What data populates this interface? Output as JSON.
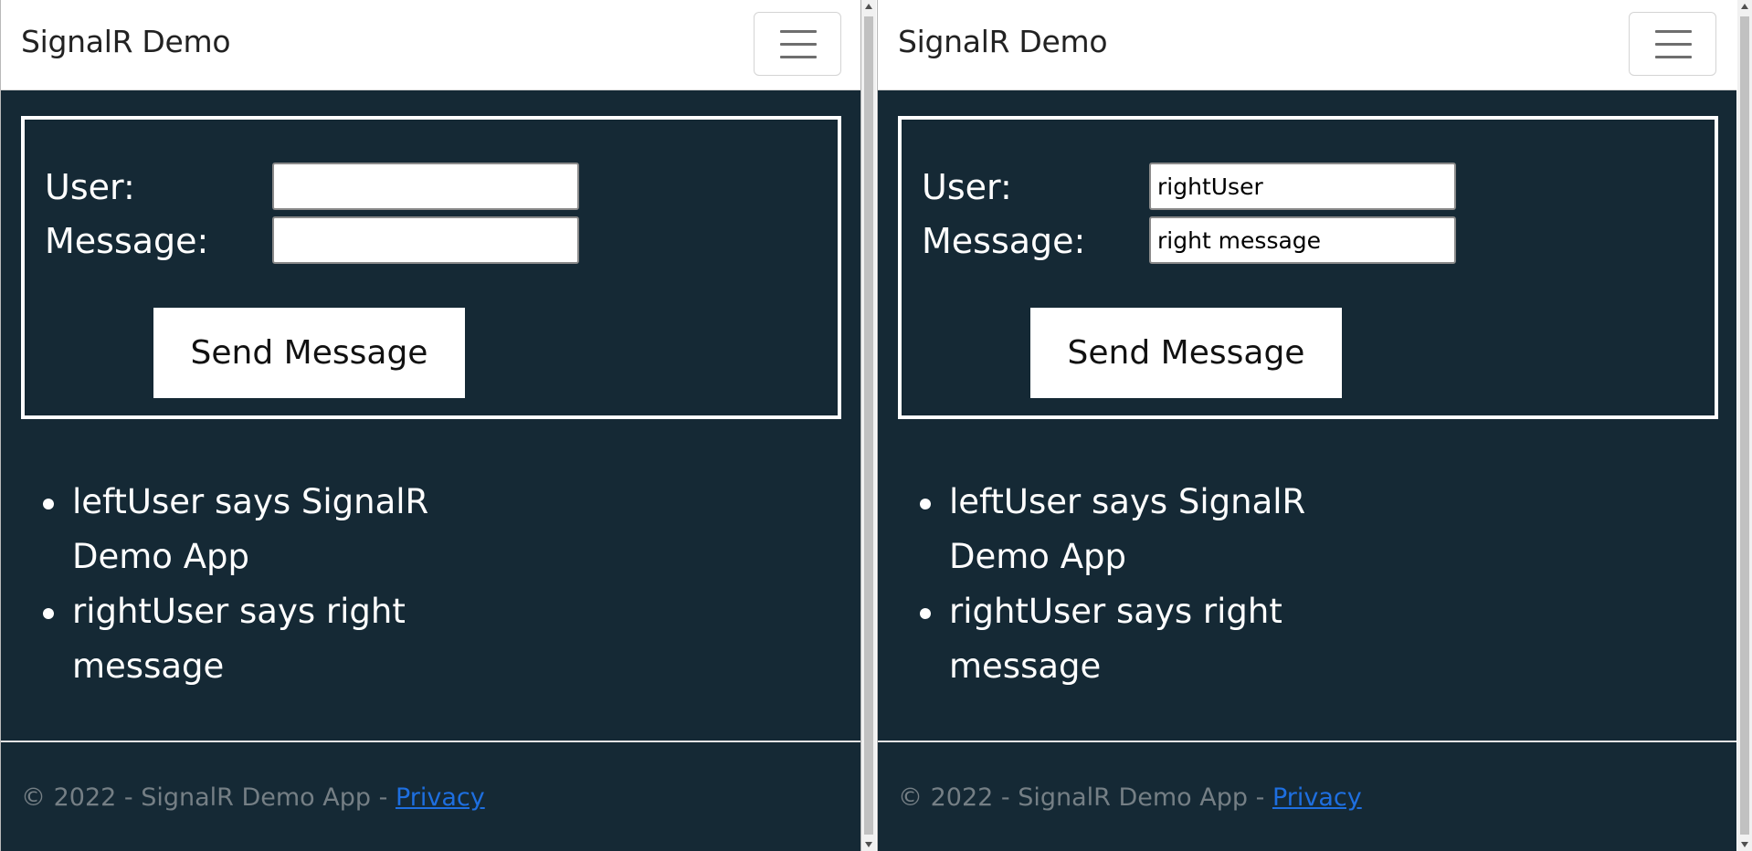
{
  "left": {
    "brand": "SignalR Demo",
    "form": {
      "user_label": "User:",
      "message_label": "Message:",
      "user_value": "",
      "message_value": "",
      "send_label": "Send Message"
    },
    "messages": [
      "leftUser says SignalR Demo App",
      "rightUser says right message"
    ],
    "footer": {
      "text": "© 2022 - SignalR Demo App - ",
      "privacy_label": "Privacy"
    }
  },
  "right": {
    "brand": "SignalR Demo",
    "form": {
      "user_label": "User:",
      "message_label": "Message:",
      "user_value": "rightUser",
      "message_value": "right message",
      "send_label": "Send Message"
    },
    "messages": [
      "leftUser says SignalR Demo App",
      "rightUser says right message"
    ],
    "footer": {
      "text": "© 2022 - SignalR Demo App - ",
      "privacy_label": "Privacy"
    }
  },
  "icons": {
    "menu": "hamburger-menu-icon",
    "bullet": "bullet-icon"
  },
  "colors": {
    "page_background": "#152935",
    "navbar_background": "#ffffff",
    "link": "#1e6fe0",
    "footer_text": "#757f85"
  }
}
